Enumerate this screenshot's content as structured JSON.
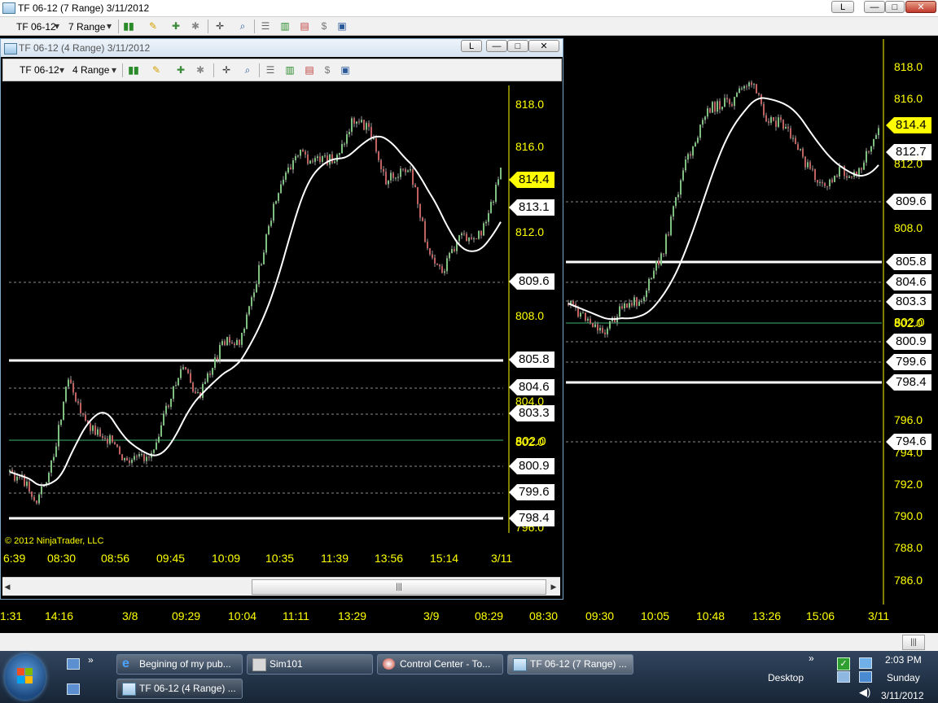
{
  "main_window": {
    "title": "TF 06-12 (7 Range)  3/11/2012",
    "buttons": {
      "layout": "L",
      "minimize": "—",
      "maximize": "□",
      "close": "✕"
    },
    "toolbar": {
      "instrument": "TF 06-12",
      "period": "7 Range"
    },
    "price_axis": [
      "818.0",
      "816.0",
      "812.0",
      "808.0",
      "802.0",
      "796.0",
      "794.0",
      "792.0",
      "790.0",
      "788.0",
      "786.0"
    ],
    "time_axis": [
      "1:31",
      "14:16",
      "3/8",
      "09:29",
      "10:04",
      "11:11",
      "13:29",
      "3/9",
      "08:29",
      "08:30",
      "09:30",
      "10:05",
      "10:48",
      "13:26",
      "15:06",
      "3/11"
    ],
    "tags": [
      {
        "value": "814.4",
        "style": "yellow"
      },
      {
        "value": "812.7",
        "style": "white"
      },
      {
        "value": "809.6",
        "style": "white"
      },
      {
        "value": "805.8",
        "style": "white"
      },
      {
        "value": "804.6",
        "style": "white"
      },
      {
        "value": "803.3",
        "style": "white"
      },
      {
        "value": "802.0",
        "style": "yellow-text"
      },
      {
        "value": "800.9",
        "style": "white"
      },
      {
        "value": "799.6",
        "style": "white"
      },
      {
        "value": "798.4",
        "style": "white"
      },
      {
        "value": "794.6",
        "style": "white"
      }
    ]
  },
  "inner_window": {
    "title": "TF 06-12 (4 Range)  3/11/2012",
    "buttons": {
      "layout": "L",
      "minimize": "—",
      "maximize": "□",
      "close": "✕"
    },
    "toolbar": {
      "instrument": "TF 06-12",
      "period": "4 Range"
    },
    "price_axis": [
      "818.0",
      "816.0",
      "812.0",
      "808.0",
      "804.0",
      "802.0",
      "796.0"
    ],
    "time_axis": [
      "6:39",
      "08:30",
      "08:56",
      "09:45",
      "10:09",
      "10:35",
      "11:39",
      "13:56",
      "15:14",
      "3/11"
    ],
    "tags": [
      {
        "value": "814.4",
        "style": "yellow"
      },
      {
        "value": "813.1",
        "style": "white"
      },
      {
        "value": "809.6",
        "style": "white"
      },
      {
        "value": "805.8",
        "style": "white"
      },
      {
        "value": "804.6",
        "style": "white"
      },
      {
        "value": "803.3",
        "style": "white"
      },
      {
        "value": "802.0",
        "style": "yellow-text"
      },
      {
        "value": "800.9",
        "style": "white"
      },
      {
        "value": "799.6",
        "style": "white"
      },
      {
        "value": "798.4",
        "style": "white"
      }
    ],
    "copyright": "© 2012 NinjaTrader, LLC",
    "scroll_grip": "|||"
  },
  "main_scroll_grip": "|||",
  "taskbar": {
    "tasks": [
      "Begining of my pub...",
      "Sim101",
      "Control Center - To...",
      "TF 06-12 (7 Range) ...",
      "TF 06-12 (4 Range) ..."
    ],
    "desktop_label": "Desktop",
    "clock": {
      "time": "2:03 PM",
      "day": "Sunday",
      "date": "3/11/2012"
    }
  },
  "colors": {
    "axis": "#ffff00",
    "grid": "#8a8a8a",
    "bull": "#7fbf7f",
    "bear": "#c06060",
    "ma": "#ffffff",
    "center_line": "#3cb371"
  }
}
